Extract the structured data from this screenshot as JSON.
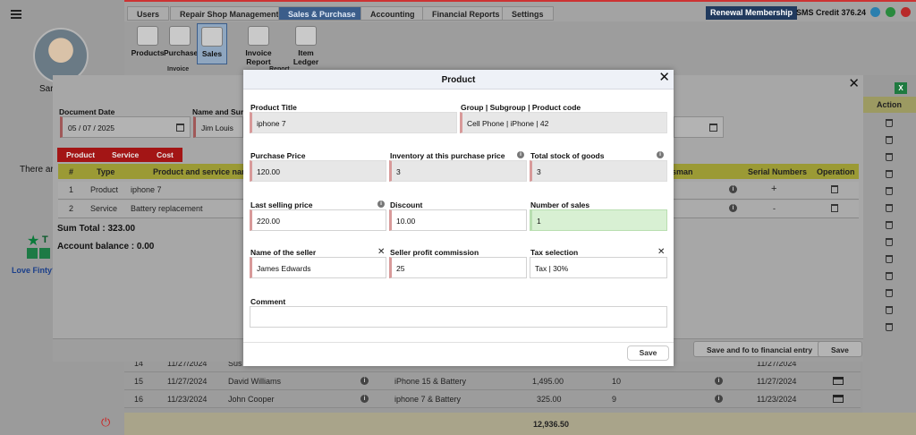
{
  "header": {
    "tabs": [
      "Users",
      "Repair Shop Management",
      "Sales & Purchase",
      "Accounting",
      "Financial Reports",
      "Settings"
    ],
    "active_tab": "Sales & Purchase",
    "renewal": "Renewal Membership",
    "sms_credit": "SMS Credit 376.24",
    "icon_colors": {
      "telegram": "#2b9fd9",
      "whatsapp": "#25a244",
      "power": "#d33"
    }
  },
  "ribbon": {
    "buttons": [
      "Products",
      "Purchase",
      "Sales",
      "Invoice Report",
      "Item Ledger"
    ],
    "groups": [
      "Invoice",
      "Report"
    ]
  },
  "sidebar": {
    "user_name": "Sar",
    "notice": "There ar",
    "trustpilot": "T",
    "love": "Love Finty?"
  },
  "sales_dialog": {
    "document_date_label": "Document Date",
    "document_date": "05 / 07 / 2025",
    "name_label": "Name and Sur",
    "name_value": "Jim Louis",
    "item_tabs": [
      "Product",
      "Service",
      "Cost"
    ],
    "columns": {
      "num": "#",
      "type": "Type",
      "name": "Product and service nam",
      "salesman": "esman",
      "serial": "Serial Numbers",
      "operation": "Operation"
    },
    "rows": [
      {
        "num": "1",
        "type": "Product",
        "name": "iphone 7",
        "salesman": "ls",
        "serial": "+"
      },
      {
        "num": "2",
        "type": "Service",
        "name": "Battery replacement",
        "salesman": "",
        "serial": "-"
      }
    ],
    "sum_total": "Sum Total : 323.00",
    "account_balance": "Account balance : 0.00",
    "save_financial": "Save and fo to financial entry",
    "save": "Save",
    "right_header": "t"
  },
  "background_table": {
    "right_header": "Action",
    "rows": [
      {
        "num": "14",
        "date": "11/27/2024",
        "customer": "Sus",
        "product": "",
        "amount": "",
        "qty": "",
        "date2": "11/27/2024"
      },
      {
        "num": "15",
        "date": "11/27/2024",
        "customer": "David Williams",
        "product": "iPhone 15 & Battery",
        "amount": "1,495.00",
        "qty": "10",
        "date2": "11/27/2024"
      },
      {
        "num": "16",
        "date": "11/23/2024",
        "customer": "John Cooper",
        "product": "iphone 7 & Battery",
        "amount": "325.00",
        "qty": "9",
        "date2": "11/23/2024"
      }
    ],
    "grand_total": "12,936.50"
  },
  "product_modal": {
    "title": "Product",
    "product_title_label": "Product Title",
    "product_title": "iphone 7",
    "group_label": "Group | Subgroup | Product code",
    "group_value": "Cell Phone | iPhone | 42",
    "purchase_price_label": "Purchase Price",
    "purchase_price": "120.00",
    "inventory_label": "Inventory at this purchase price",
    "inventory": "3",
    "total_stock_label": "Total stock of goods",
    "total_stock": "3",
    "last_price_label": "Last selling price",
    "last_price": "220.00",
    "discount_label": "Discount",
    "discount": "10.00",
    "sales_count_label": "Number of sales",
    "sales_count": "1",
    "seller_label": "Name of the seller",
    "seller": "James Edwards",
    "commission_label": "Seller profit commission",
    "commission": "25",
    "tax_label": "Tax selection",
    "tax": "Tax | 30%",
    "comment_label": "Comment",
    "comment": "",
    "save": "Save"
  }
}
